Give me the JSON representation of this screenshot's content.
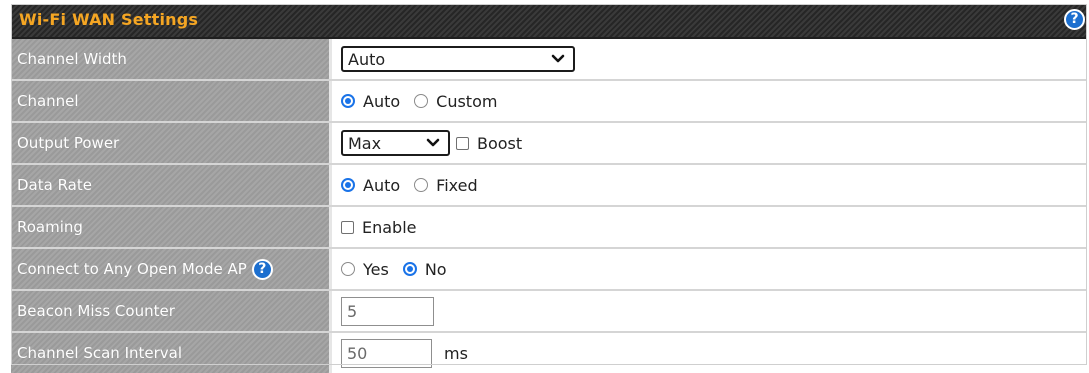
{
  "header": {
    "title": "Wi-Fi WAN Settings",
    "help_glyph": "?"
  },
  "rows": {
    "channel_width": {
      "label": "Channel Width",
      "value": "Auto"
    },
    "channel": {
      "label": "Channel",
      "options": [
        "Auto",
        "Custom"
      ],
      "selected": "Auto"
    },
    "output_power": {
      "label": "Output Power",
      "value": "Max",
      "boost_label": "Boost",
      "boost_checked": false
    },
    "data_rate": {
      "label": "Data Rate",
      "options": [
        "Auto",
        "Fixed"
      ],
      "selected": "Auto"
    },
    "roaming": {
      "label": "Roaming",
      "enable_label": "Enable",
      "checked": false
    },
    "connect_open_ap": {
      "label": "Connect to Any Open Mode AP",
      "help_glyph": "?",
      "options": [
        "Yes",
        "No"
      ],
      "selected": "No"
    },
    "beacon_miss_counter": {
      "label": "Beacon Miss Counter",
      "value": "5"
    },
    "channel_scan_interval": {
      "label": "Channel Scan Interval",
      "value": "50",
      "unit": "ms"
    }
  },
  "colors": {
    "header_title": "#f5a623",
    "radio_accent": "#1a73e8",
    "help_blue": "#1c6fcf"
  },
  "icons": {
    "help": "question-circle-icon",
    "dropdown": "chevron-down-icon"
  }
}
